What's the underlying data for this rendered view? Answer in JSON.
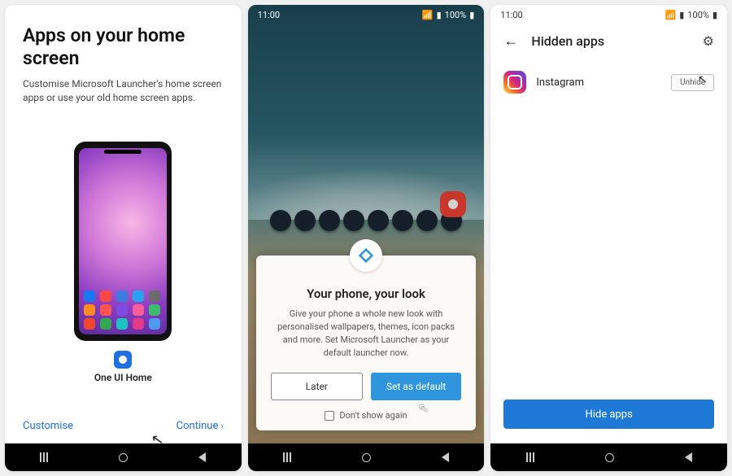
{
  "screen1": {
    "title": "Apps on your home screen",
    "subtitle": "Customise Microsoft Launcher's home screen apps or use your old home screen apps.",
    "launcher_label": "One UI Home",
    "customise": "Customise",
    "continue": "Continue"
  },
  "screen2": {
    "time": "11:00",
    "battery": "100%",
    "dialog_title": "Your phone, your look",
    "dialog_text": "Give your phone a whole new look with personalised wallpapers, themes, icon packs and more. Set Microsoft Launcher as your default launcher now.",
    "later": "Later",
    "set_default": "Set as default",
    "dont_show": "Don't show again"
  },
  "screen3": {
    "time": "11:00",
    "battery": "100%",
    "title": "Hidden apps",
    "app_name": "Instagram",
    "unhide": "Unhide",
    "hide_apps": "Hide apps"
  }
}
